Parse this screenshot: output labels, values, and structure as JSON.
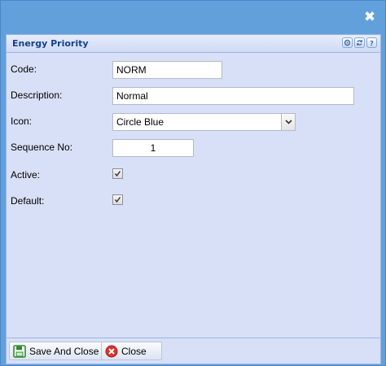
{
  "window": {
    "close_glyph": "✖"
  },
  "panel": {
    "title": "Energy Priority",
    "tools": [
      "gear-icon",
      "refresh-icon",
      "help-icon"
    ]
  },
  "form": {
    "code": {
      "label": "Code:",
      "value": "NORM"
    },
    "description": {
      "label": "Description:",
      "value": "Normal"
    },
    "icon": {
      "label": "Icon:",
      "value": "Circle Blue"
    },
    "sequence": {
      "label": "Sequence No:",
      "value": "1"
    },
    "active": {
      "label": "Active:",
      "checked": true
    },
    "default": {
      "label": "Default:",
      "checked": true
    }
  },
  "footer": {
    "save_label": "Save And Close",
    "close_label": "Close"
  },
  "colors": {
    "window_bg": "#62a0dc",
    "panel_bg": "#d8e0f7",
    "title_text": "#15428b",
    "save_icon": "#2e8b2e",
    "close_icon": "#d9332b"
  }
}
